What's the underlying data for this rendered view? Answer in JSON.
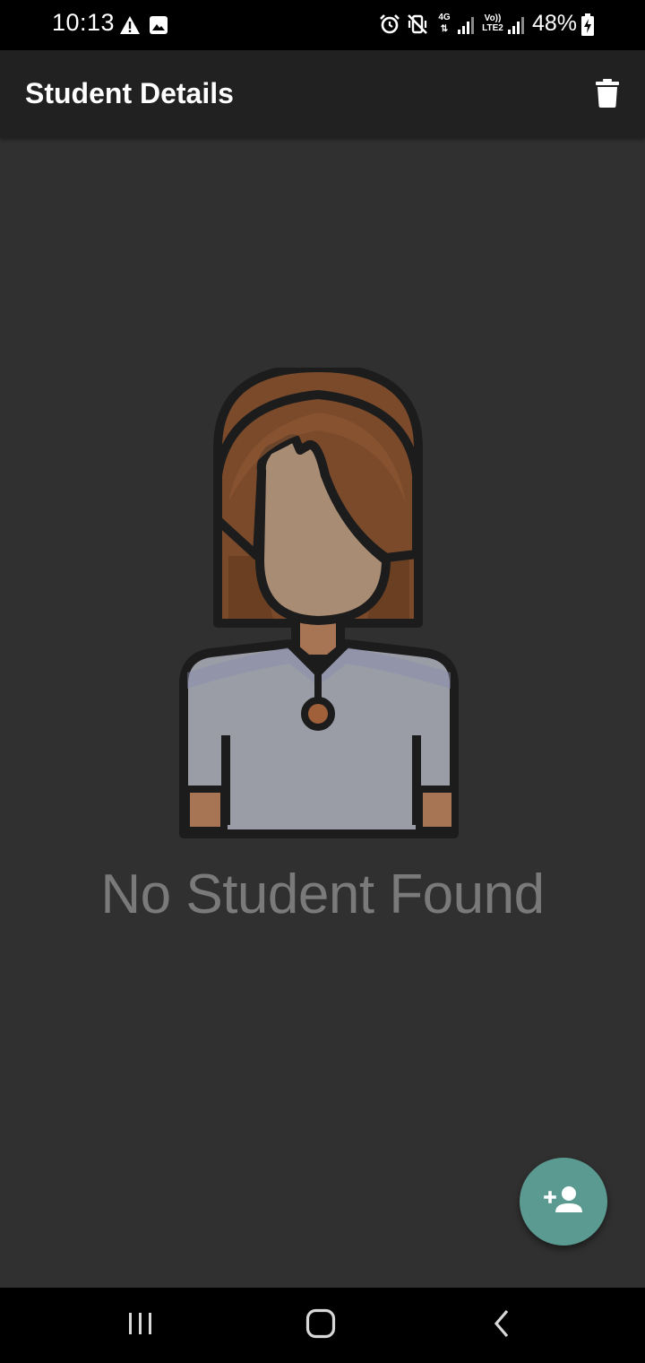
{
  "status_bar": {
    "time": "10:13",
    "battery_percent": "48%",
    "network_4g": "4G",
    "network_volte_top": "Vo))",
    "network_volte_bottom": "LTE2",
    "icons": [
      "warning-icon",
      "image-icon",
      "alarm-icon",
      "vibrate-icon",
      "signal-icon",
      "battery-charging-icon"
    ]
  },
  "app_bar": {
    "title": "Student Details",
    "action_icon": "delete-icon"
  },
  "empty_state": {
    "message": "No Student Found",
    "illustration": "student-avatar-illustration"
  },
  "fab": {
    "icon": "add-person-icon",
    "color": "#5b9a91"
  },
  "nav_bar": {
    "icons": [
      "recents-icon",
      "home-icon",
      "back-icon"
    ]
  },
  "colors": {
    "background": "#303030",
    "app_bar": "#212121",
    "status_bar": "#000000",
    "empty_text": "#7a7a7a",
    "accent": "#5b9a91"
  }
}
